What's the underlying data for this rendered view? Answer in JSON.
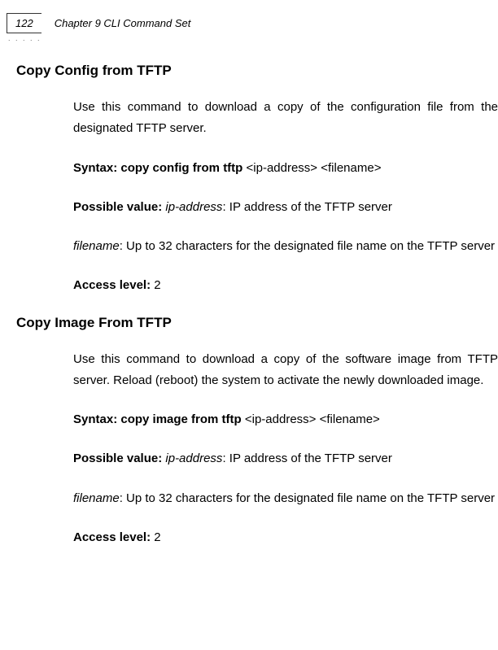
{
  "header": {
    "pageNumber": "122",
    "chapterTitle": "Chapter 9 CLI Command Set"
  },
  "sections": [
    {
      "heading": "Copy Config from TFTP",
      "description": "Use this command to download a copy of the configuration file from the designated TFTP server.",
      "syntaxLabel": "Syntax: copy config from tftp ",
      "syntaxArgs": "<ip-address> <filename>",
      "possibleLabel": "Possible value: ",
      "possibleItalic": "ip-address",
      "possibleRest": ": IP address of the TFTP server",
      "filenameItalic": "filename",
      "filenameRest": ": Up to 32 characters for the designated file name on the TFTP server",
      "accessLabel": "Access level: ",
      "accessValue": "2"
    },
    {
      "heading": "Copy Image From TFTP",
      "description": "Use this command to download a copy of the software image from TFTP server. Reload (reboot) the system to activate the newly downloaded image.",
      "syntaxLabel": "Syntax: copy image from tftp ",
      "syntaxArgs": "<ip-address> <filename>",
      "possibleLabel": "Possible value: ",
      "possibleItalic": "ip-address",
      "possibleRest": ": IP address of the TFTP server",
      "filenameItalic": "filename",
      "filenameRest": ": Up to 32 characters for the designated file name on the TFTP server",
      "accessLabel": "Access level: ",
      "accessValue": "2"
    }
  ]
}
